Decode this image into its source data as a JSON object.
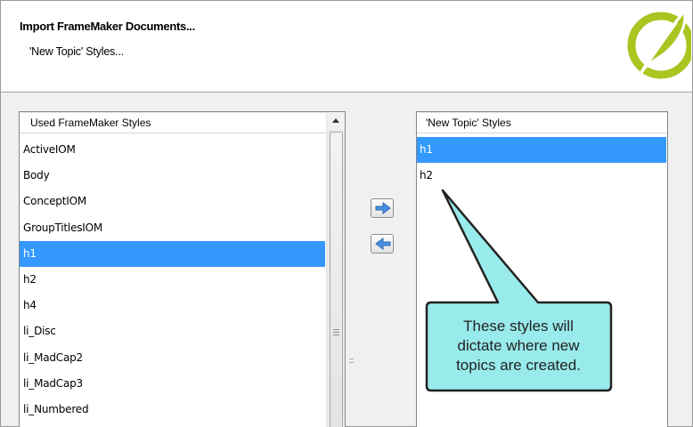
{
  "dialog": {
    "title": "Import FrameMaker Documents...",
    "subtitle": "'New Topic' Styles..."
  },
  "logo": {
    "icon": "quill-feather-logo-icon",
    "color": "#a8c520"
  },
  "left_list": {
    "header": "Used FrameMaker Styles",
    "items": [
      "ActiveIOM",
      "Body",
      "ConceptIOM",
      "GroupTitlesIOM",
      "h1",
      "h2",
      "h4",
      "li_Disc",
      "li_MadCap2",
      "li_MadCap3",
      "li_Numbered"
    ],
    "selected": "h1"
  },
  "right_list": {
    "header": "'New Topic' Styles",
    "items": [
      "h1",
      "h2"
    ],
    "selected": "h1"
  },
  "buttons": {
    "add_icon": "arrow-right-icon",
    "remove_icon": "arrow-left-icon"
  },
  "callout": {
    "lines": [
      "These styles will",
      "dictate where new",
      "topics are created."
    ],
    "fill": "#99eaea",
    "border": "#222222"
  },
  "colors": {
    "selection": "#3399ff",
    "arrow": "#4a90e2"
  }
}
